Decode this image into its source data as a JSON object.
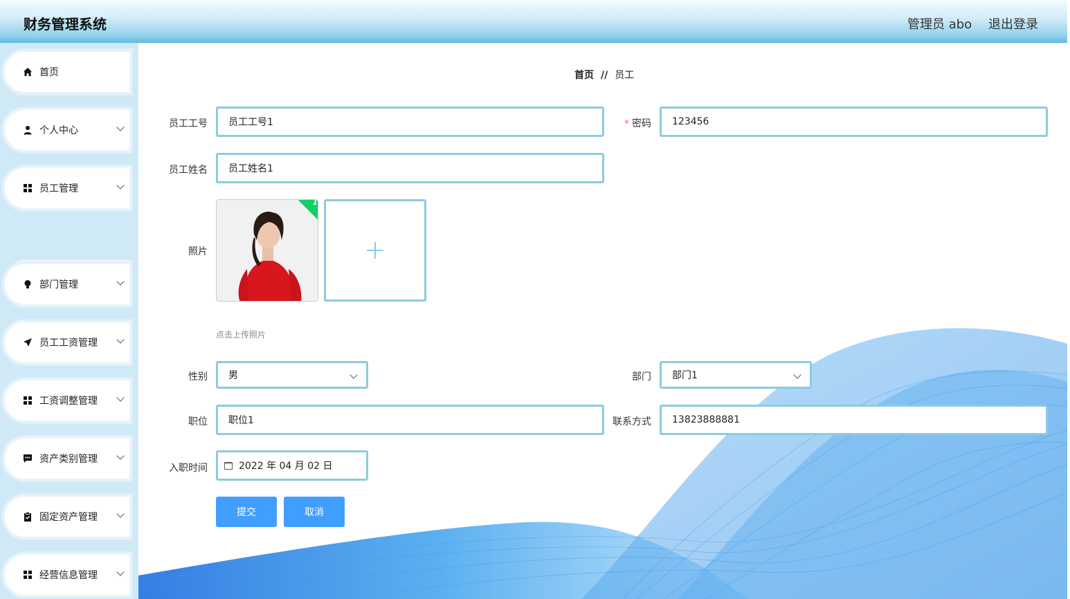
{
  "header": {
    "title": "财务管理系统",
    "user": "管理员 abo",
    "logout": "退出登录"
  },
  "sidebar": {
    "items": [
      {
        "label": "首页",
        "icon": "home-icon"
      },
      {
        "label": "个人中心",
        "icon": "user-icon"
      },
      {
        "label": "员工管理",
        "icon": "grid-icon"
      },
      {
        "label": "部门管理",
        "icon": "bulb-icon"
      },
      {
        "label": "员工工资管理",
        "icon": "send-icon"
      },
      {
        "label": "工资调整管理",
        "icon": "grid-icon"
      },
      {
        "label": "资产类别管理",
        "icon": "chat-icon"
      },
      {
        "label": "固定资产管理",
        "icon": "clipboard-icon"
      },
      {
        "label": "经营信息管理",
        "icon": "grid-icon"
      }
    ],
    "submenu": {
      "label": "员工"
    }
  },
  "breadcrumb": {
    "home": "首页",
    "sep": "//",
    "current": "员工"
  },
  "form": {
    "emp_id": {
      "label": "员工工号",
      "value": "员工工号1"
    },
    "password": {
      "label": "密码",
      "required_mark": "*",
      "value": "123456"
    },
    "emp_name": {
      "label": "员工姓名",
      "value": "员工姓名1"
    },
    "photo": {
      "label": "照片",
      "hint": "点击上传照片"
    },
    "gender": {
      "label": "性别",
      "value": "男"
    },
    "department": {
      "label": "部门",
      "value": "部门1"
    },
    "position": {
      "label": "职位",
      "value": "职位1"
    },
    "contact": {
      "label": "联系方式",
      "value": "13823888881"
    },
    "hire_date": {
      "label": "入职时间",
      "value": "2022 年 04 月 02 日"
    },
    "submit": "提交",
    "cancel": "取消"
  },
  "colors": {
    "accent": "#409eff",
    "input_border": "#8ccbe0",
    "success": "#13ce66"
  }
}
